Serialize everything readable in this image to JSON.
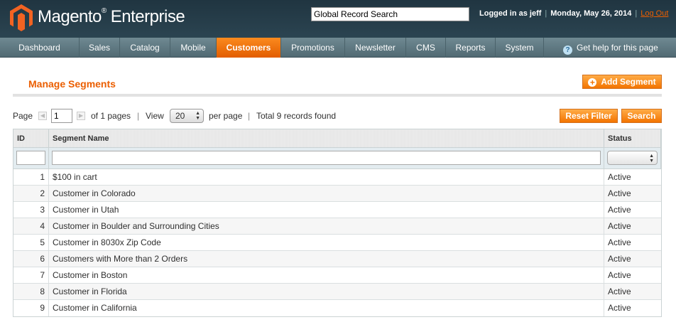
{
  "header": {
    "logo_name": "Magento",
    "logo_sup": "®",
    "edition": "Enterprise",
    "search_value": "Global Record Search",
    "logged_in": "Logged in as jeff",
    "date": "Monday, May 26, 2014",
    "logout": "Log Out"
  },
  "nav": {
    "items": [
      {
        "label": "Dashboard"
      },
      {
        "label": "Sales"
      },
      {
        "label": "Catalog"
      },
      {
        "label": "Mobile"
      },
      {
        "label": "Customers"
      },
      {
        "label": "Promotions"
      },
      {
        "label": "Newsletter"
      },
      {
        "label": "CMS"
      },
      {
        "label": "Reports"
      },
      {
        "label": "System"
      }
    ],
    "active": "Customers",
    "help": "Get help for this page"
  },
  "page": {
    "title": "Manage Segments",
    "add_button": "Add Segment"
  },
  "pager": {
    "page_label": "Page",
    "page_value": "1",
    "of_pages": "of 1 pages",
    "view_label": "View",
    "per_page_value": "20",
    "per_page_label": "per page",
    "total": "Total 9 records found",
    "reset_button": "Reset Filter",
    "search_button": "Search"
  },
  "grid": {
    "columns": {
      "id": "ID",
      "name": "Segment Name",
      "status": "Status"
    },
    "rows": [
      {
        "id": "1",
        "name": "$100 in cart",
        "status": "Active"
      },
      {
        "id": "2",
        "name": "Customer in Colorado",
        "status": "Active"
      },
      {
        "id": "3",
        "name": "Customer in Utah",
        "status": "Active"
      },
      {
        "id": "4",
        "name": "Customer in Boulder and Surrounding Cities",
        "status": "Active"
      },
      {
        "id": "5",
        "name": "Customer in 8030x Zip Code",
        "status": "Active"
      },
      {
        "id": "6",
        "name": "Customers with More than 2 Orders",
        "status": "Active"
      },
      {
        "id": "7",
        "name": "Customer in Boston",
        "status": "Active"
      },
      {
        "id": "8",
        "name": "Customer in Florida",
        "status": "Active"
      },
      {
        "id": "9",
        "name": "Customer in California",
        "status": "Active"
      }
    ]
  },
  "colors": {
    "accent": "#eb5e00",
    "header_bg": "#203541",
    "nav_bg": "#5f7a83"
  },
  "icons": {
    "logo": "magento-logo-icon",
    "help": "help-icon",
    "add": "plus-icon"
  }
}
